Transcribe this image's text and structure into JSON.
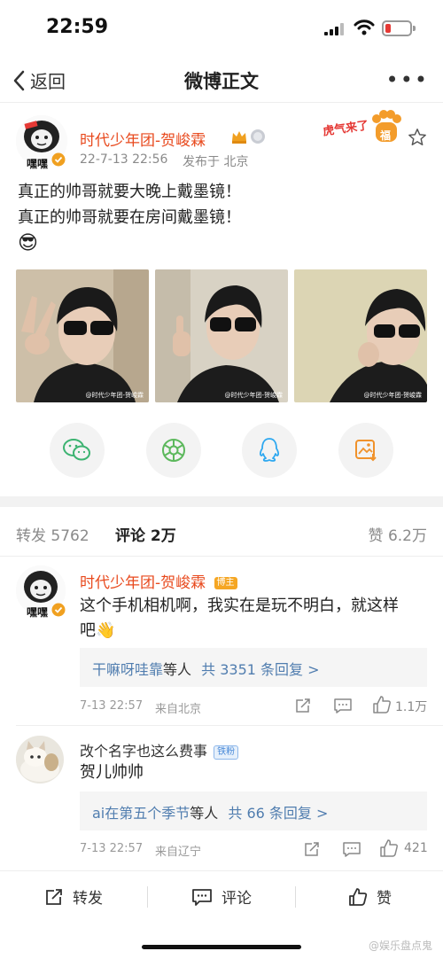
{
  "status_bar": {
    "time": "22:59"
  },
  "nav": {
    "back_label": "返回",
    "title": "微博正文",
    "more_label": "•••"
  },
  "post": {
    "avatar_caption": "嘿嘿",
    "username": "时代少年团-贺峻霖",
    "timestamp": "22-7-13 22:56",
    "location": "发布于 北京",
    "sticker_text": "虎气来了",
    "sticker_badge": "福",
    "lines": [
      "真正的帅哥就要大晚上戴墨镜！",
      "真正的帅哥就要在房间戴墨镜！"
    ],
    "emoji": "😎",
    "photo_watermark": "@时代少年团-贺峻霖"
  },
  "share": {
    "items": [
      "wechat-icon",
      "moments-icon",
      "qq-icon",
      "save-image-icon"
    ]
  },
  "tabs": {
    "repost": "转发 5762",
    "comments": "评论 2万",
    "likes": "赞 6.2万"
  },
  "comments": [
    {
      "avatar_caption": "嘿嘿",
      "username": "时代少年团-贺峻霖",
      "badge": "博主",
      "text_line1": "这个手机相机啊，我实在是玩不明白，就这样",
      "text_line2": "吧👋",
      "reply_users": "干嘛呀哇靠",
      "reply_mid": "等人",
      "reply_count": "共 3351 条回复 >",
      "time": "7-13 22:57",
      "location": "来自北京",
      "likes": "1.1万"
    },
    {
      "username": "改个名字也这么费事",
      "badge": "铁粉",
      "text": "贺儿帅帅",
      "reply_users": "ai在第五个季节",
      "reply_mid": "等人",
      "reply_count": "共 66 条回复 >",
      "time": "7-13 22:57",
      "location": "来自辽宁",
      "likes": "421"
    }
  ],
  "bottom_bar": {
    "repost": "转发",
    "comment": "评论",
    "like": "赞"
  },
  "watermark": "@娱乐盘点鬼",
  "colors": {
    "accent": "#e8491d",
    "link": "#507daf",
    "gold": "#f0a020"
  }
}
